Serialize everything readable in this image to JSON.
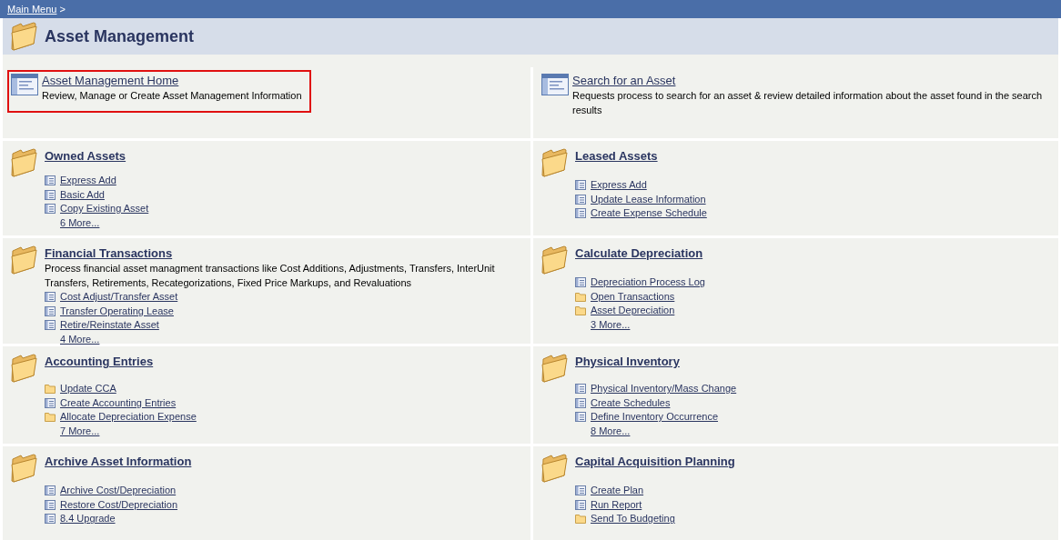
{
  "breadcrumb": {
    "link": "Main Menu",
    "separator": ">"
  },
  "title": "Asset Management",
  "top_entries": [
    {
      "title": "Asset Management Home",
      "description": "Review, Manage or Create Asset Management Information",
      "highlighted": true
    },
    {
      "title": "Search for an Asset",
      "description": "Requests process to search for an asset & review detailed information about the asset found in the search results",
      "highlighted": false
    }
  ],
  "sections": [
    {
      "title": "Owned Assets",
      "items": [
        {
          "label": "Express Add",
          "kind": "page"
        },
        {
          "label": "Basic Add",
          "kind": "page"
        },
        {
          "label": "Copy Existing Asset",
          "kind": "page"
        }
      ],
      "more": "6 More..."
    },
    {
      "title": "Leased Assets",
      "items": [
        {
          "label": "Express Add",
          "kind": "page"
        },
        {
          "label": "Update Lease Information",
          "kind": "page"
        },
        {
          "label": "Create Expense Schedule",
          "kind": "page"
        }
      ]
    },
    {
      "title": "Financial Transactions",
      "description": "Process financial asset managment transactions like Cost Additions, Adjustments, Transfers, InterUnit Transfers, Retirements, Recategorizations, Fixed Price Markups, and Revaluations",
      "items": [
        {
          "label": "Cost Adjust/Transfer Asset",
          "kind": "page"
        },
        {
          "label": "Transfer Operating Lease",
          "kind": "page"
        },
        {
          "label": "Retire/Reinstate Asset",
          "kind": "page"
        }
      ],
      "more": "4 More..."
    },
    {
      "title": "Calculate Depreciation",
      "items": [
        {
          "label": "Depreciation Process Log",
          "kind": "page"
        },
        {
          "label": "Open Transactions",
          "kind": "folder"
        },
        {
          "label": "Asset Depreciation",
          "kind": "folder"
        }
      ],
      "more": "3 More..."
    },
    {
      "title": "Accounting Entries",
      "items": [
        {
          "label": "Update CCA",
          "kind": "folder"
        },
        {
          "label": "Create Accounting Entries",
          "kind": "page"
        },
        {
          "label": "Allocate Depreciation Expense",
          "kind": "folder"
        }
      ],
      "more": "7 More..."
    },
    {
      "title": "Physical Inventory",
      "items": [
        {
          "label": "Physical Inventory/Mass Change",
          "kind": "page"
        },
        {
          "label": "Create Schedules",
          "kind": "page"
        },
        {
          "label": "Define Inventory Occurrence",
          "kind": "page"
        }
      ],
      "more": "8 More..."
    },
    {
      "title": "Archive Asset Information",
      "items": [
        {
          "label": "Archive Cost/Depreciation",
          "kind": "page"
        },
        {
          "label": "Restore Cost/Depreciation",
          "kind": "page"
        },
        {
          "label": "8.4 Upgrade",
          "kind": "page"
        }
      ]
    },
    {
      "title": "Capital Acquisition Planning",
      "items": [
        {
          "label": "Create Plan",
          "kind": "page"
        },
        {
          "label": "Run Report",
          "kind": "page"
        },
        {
          "label": "Send To Budgeting",
          "kind": "folder"
        }
      ]
    }
  ]
}
